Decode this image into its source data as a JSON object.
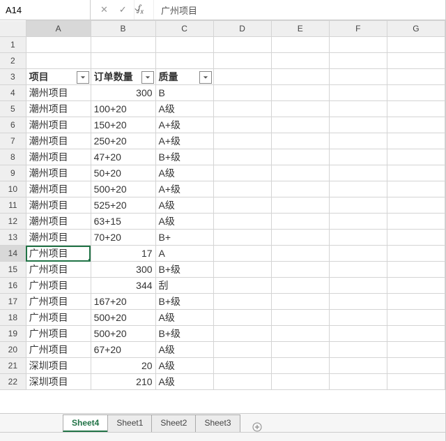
{
  "namebox": {
    "value": "A14"
  },
  "formula": {
    "value": "广州项目"
  },
  "columns": [
    "A",
    "B",
    "C",
    "D",
    "E",
    "F",
    "G"
  ],
  "selected_col": "A",
  "selected_row": 14,
  "row_start": 1,
  "row_end": 22,
  "table": {
    "header_row": 3,
    "headers": {
      "A": "项目",
      "B": "订单数量",
      "C": "质量"
    },
    "rows": [
      {
        "r": 4,
        "A": "潮州项目",
        "B": "300",
        "B_num": true,
        "C": "B"
      },
      {
        "r": 5,
        "A": "潮州项目",
        "B": "100+20",
        "C": "A级"
      },
      {
        "r": 6,
        "A": "潮州项目",
        "B": "150+20",
        "C": "  A+级"
      },
      {
        "r": 7,
        "A": "潮州项目",
        "B": "250+20",
        "C": "A+级"
      },
      {
        "r": 8,
        "A": "潮州项目",
        "B": "47+20",
        "C": "B+级"
      },
      {
        "r": 9,
        "A": "潮州项目",
        "B": "50+20",
        "C": "A级"
      },
      {
        "r": 10,
        "A": "潮州项目",
        "B": "500+20",
        "C": "A+级"
      },
      {
        "r": 11,
        "A": "潮州项目",
        "B": "525+20",
        "C": "  A级"
      },
      {
        "r": 12,
        "A": "潮州项目",
        "B": "63+15",
        "C": "A级"
      },
      {
        "r": 13,
        "A": "潮州项目",
        "B": "70+20",
        "C": "B+"
      },
      {
        "r": 14,
        "A": "广州项目",
        "B": "17",
        "B_num": true,
        "C": "A"
      },
      {
        "r": 15,
        "A": "广州项目",
        "B": "300",
        "B_num": true,
        "C": "B+级"
      },
      {
        "r": 16,
        "A": "广州项目",
        "B": "344",
        "B_num": true,
        "C": "刮"
      },
      {
        "r": 17,
        "A": "广州项目",
        "B": "167+20",
        "C": "B+级"
      },
      {
        "r": 18,
        "A": "广州项目",
        "B": "500+20",
        "C": "A级"
      },
      {
        "r": 19,
        "A": "广州项目",
        "B": "500+20",
        "C": "B+级"
      },
      {
        "r": 20,
        "A": "广州项目",
        "B": "67+20",
        "C": "A级"
      },
      {
        "r": 21,
        "A": "深圳项目",
        "B": "20",
        "B_num": true,
        "C": "A级"
      },
      {
        "r": 22,
        "A": "深圳项目",
        "B": "210",
        "B_num": true,
        "C": "A级"
      }
    ]
  },
  "sheets": {
    "active": "Sheet4",
    "tabs": [
      "Sheet4",
      "Sheet1",
      "Sheet2",
      "Sheet3"
    ]
  },
  "icons": {
    "cancel": "✕",
    "confirm": "✓"
  }
}
